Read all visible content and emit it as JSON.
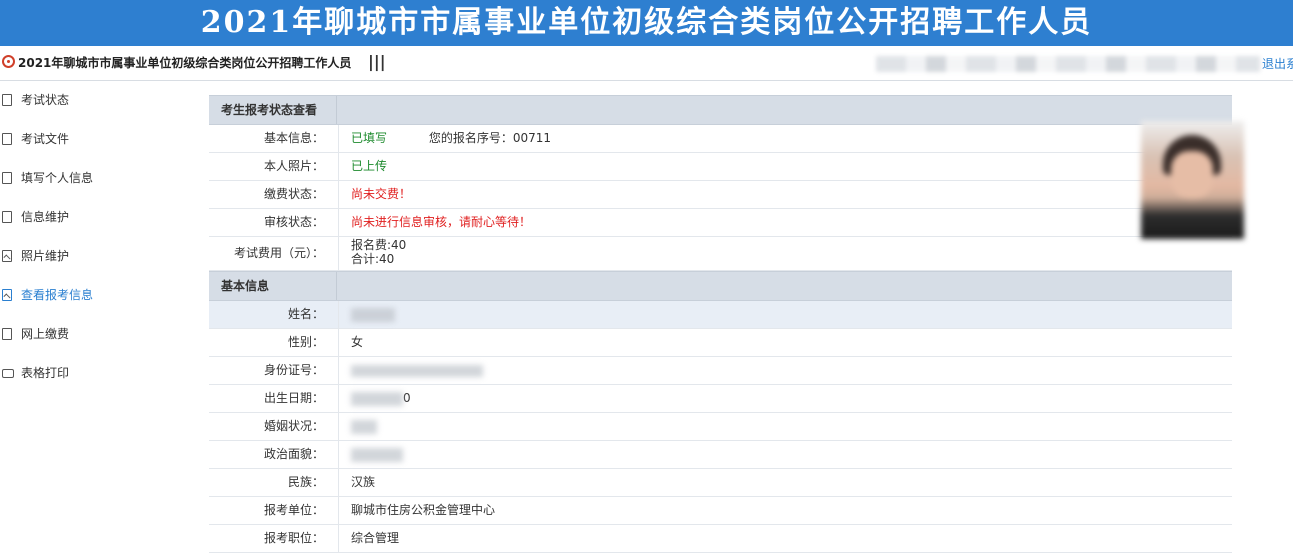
{
  "banner": {
    "title": "2021年聊城市市属事业单位初级综合类岗位公开招聘工作人员"
  },
  "topbar": {
    "site_title": "2021年聊城市市属事业单位初级综合类岗位公开招聘工作人员",
    "menu_toggle": "|||",
    "logout": "退出系"
  },
  "sidebar": {
    "items": [
      {
        "label": "考试状态",
        "icon": "document-icon",
        "active": false
      },
      {
        "label": "考试文件",
        "icon": "document-icon",
        "active": false
      },
      {
        "label": "填写个人信息",
        "icon": "edit-icon",
        "active": false
      },
      {
        "label": "信息维护",
        "icon": "edit-icon",
        "active": false
      },
      {
        "label": "照片维护",
        "icon": "image-icon",
        "active": false
      },
      {
        "label": "查看报考信息",
        "icon": "image-icon",
        "active": true
      },
      {
        "label": "网上缴费",
        "icon": "payment-icon",
        "active": false
      },
      {
        "label": "表格打印",
        "icon": "print-icon",
        "active": false
      }
    ]
  },
  "status": {
    "header": "考生报考状态查看",
    "basic_info_label": "基本信息：",
    "basic_info_value": "已填写",
    "reg_no_text": "您的报名序号：00711",
    "photo_label": "本人照片：",
    "photo_value": "已上传",
    "payment_label": "缴费状态：",
    "payment_value": "尚未交费！",
    "review_label": "审核状态：",
    "review_value": "尚未进行信息审核，请耐心等待！",
    "fee_label": "考试费用（元）：",
    "fee_line1": "报名费:40",
    "fee_line2": "合计:40"
  },
  "basic": {
    "header": "基本信息",
    "name_label": "姓名：",
    "gender_label": "性别：",
    "gender_value": "女",
    "id_label": "身份证号：",
    "birth_label": "出生日期：",
    "birth_value_tail": "0",
    "marital_label": "婚姻状况：",
    "political_label": "政治面貌：",
    "ethnic_label": "民族：",
    "ethnic_value": "汉族",
    "unit_label": "报考单位：",
    "unit_value": "聊城市住房公积金管理中心",
    "position_label": "报考职位：",
    "position_value": "综合管理"
  }
}
